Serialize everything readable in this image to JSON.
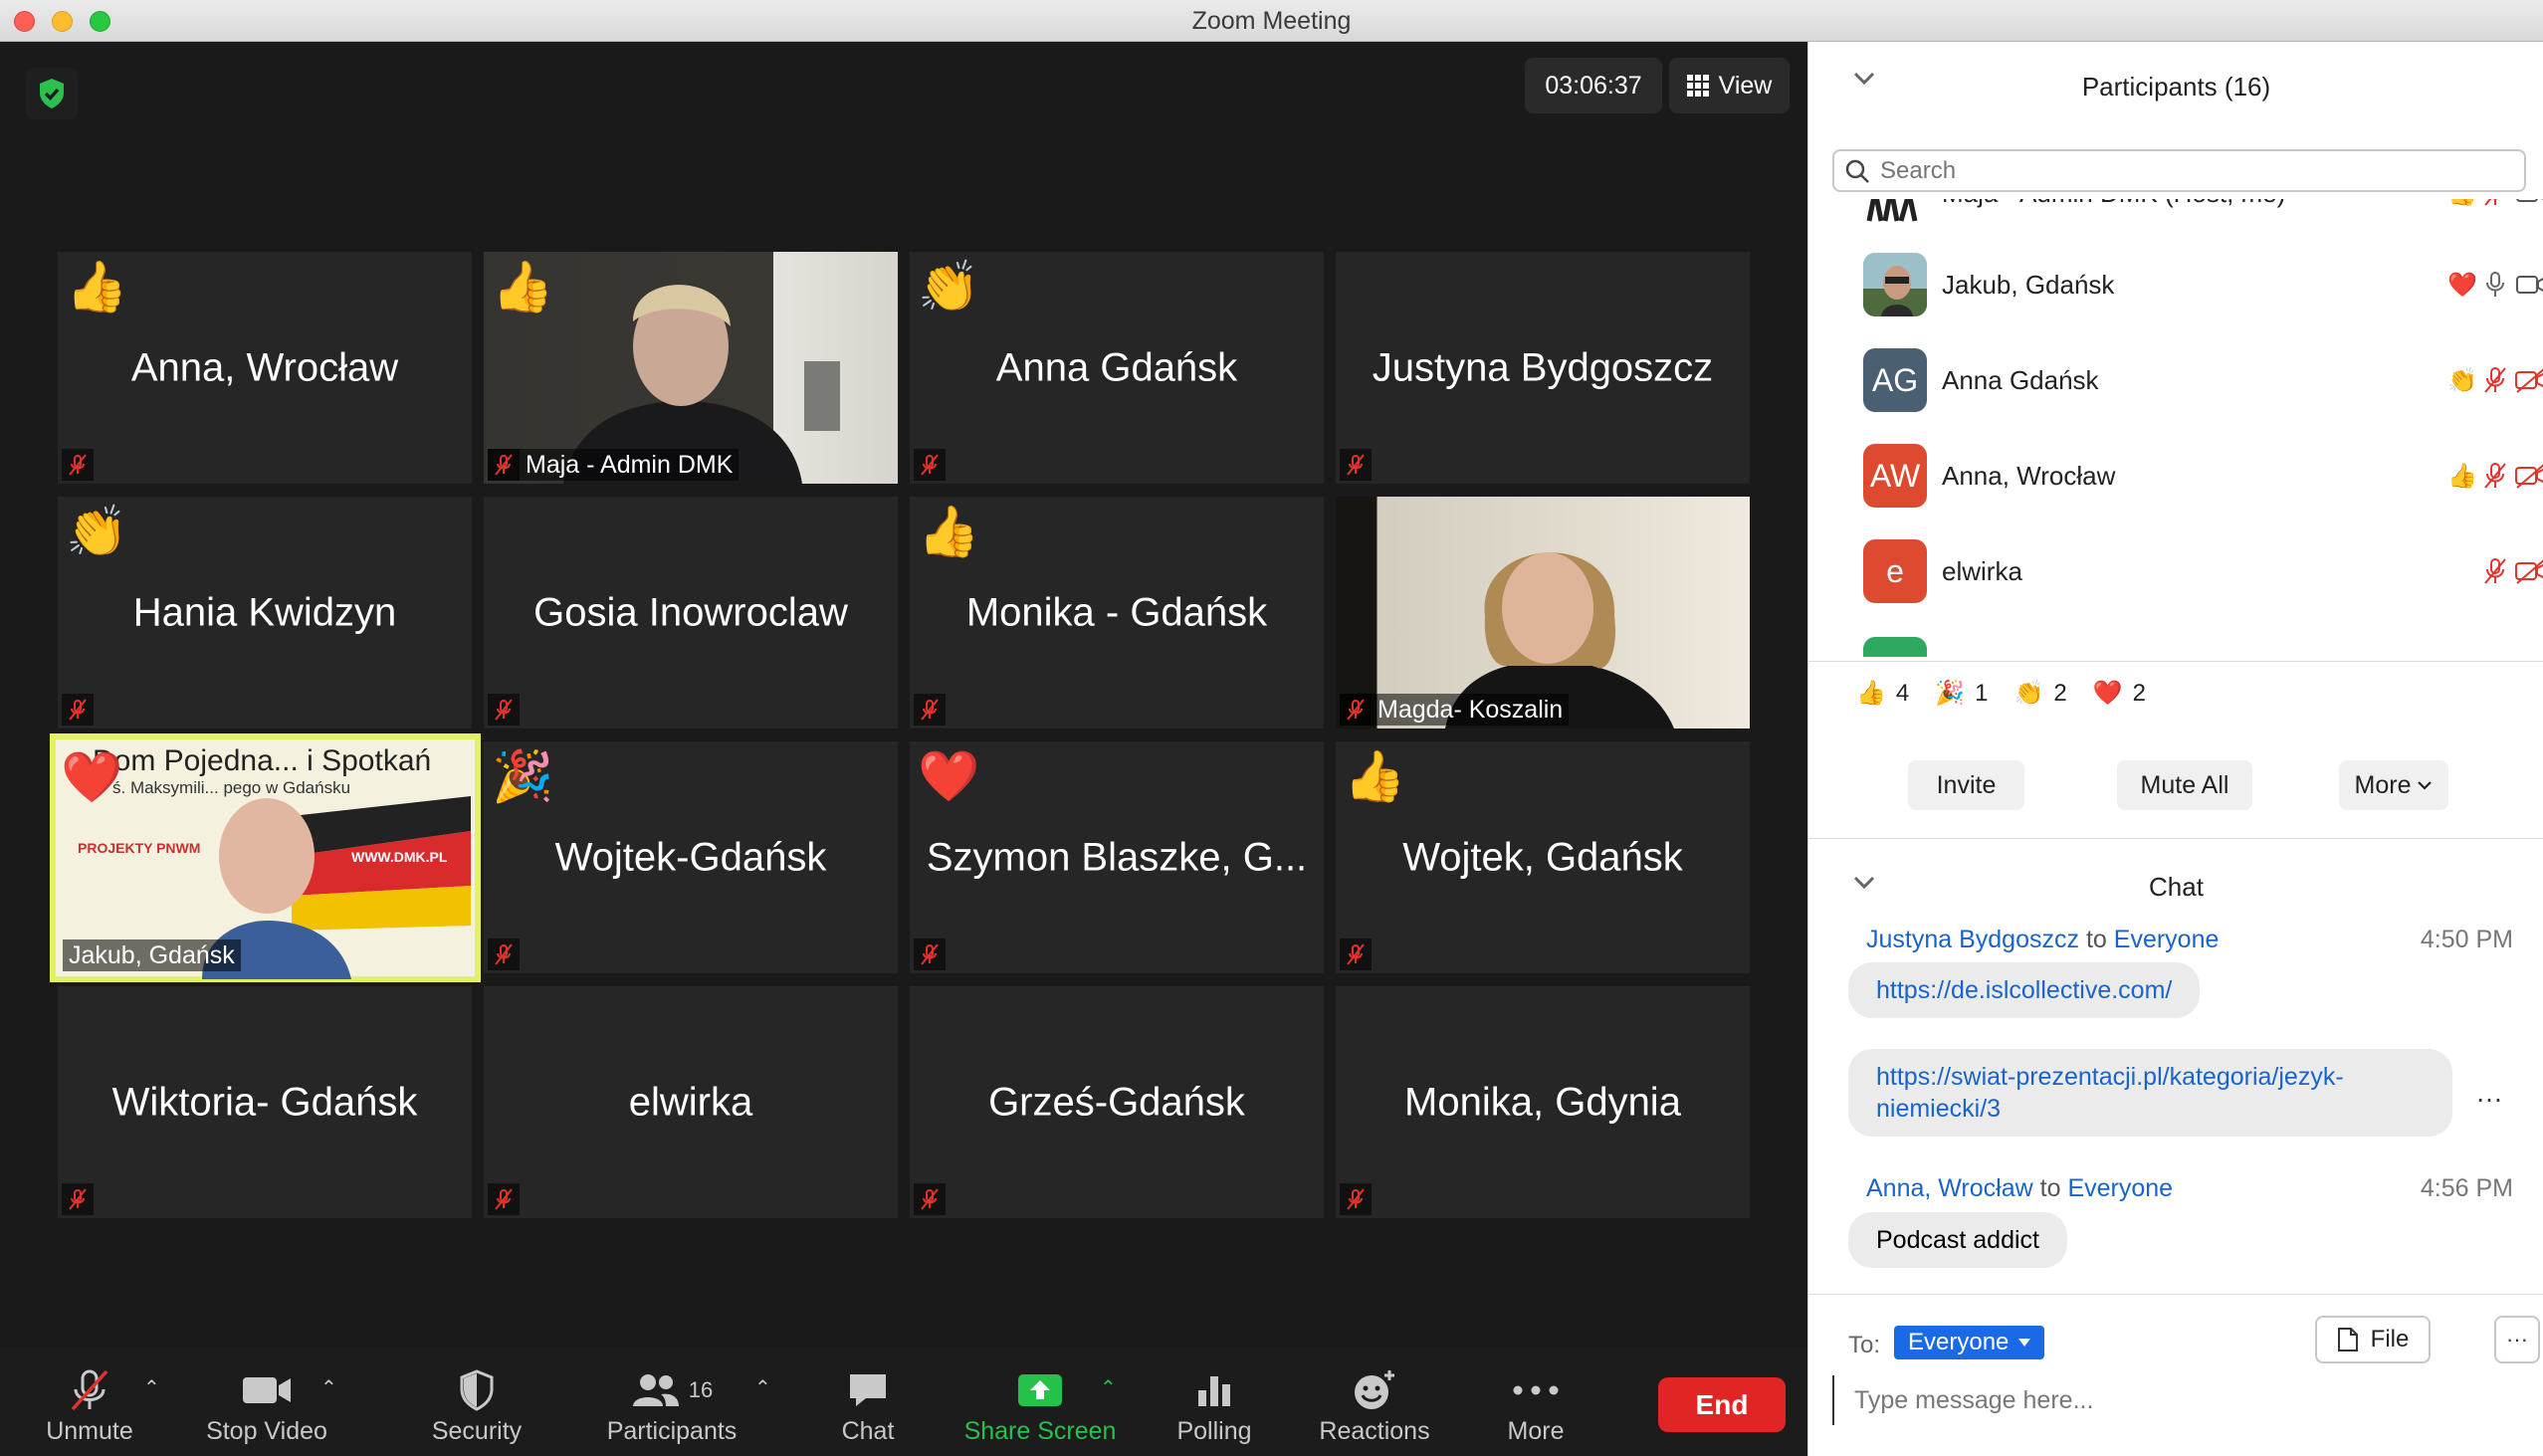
{
  "window": {
    "title": "Zoom Meeting"
  },
  "meeting": {
    "timer": "03:06:37",
    "view_label": "View"
  },
  "tiles": [
    {
      "name": "Anna, Wrocław",
      "reaction": "👍"
    },
    {
      "name": "Maja - Admin DMK",
      "reaction": "👍"
    },
    {
      "name": "Anna Gdańsk",
      "reaction": "👏"
    },
    {
      "name": "Justyna  Bydgoszcz",
      "reaction": ""
    },
    {
      "name": "Hania Kwidzyn",
      "reaction": "👏"
    },
    {
      "name": "Gosia Inowroclaw",
      "reaction": ""
    },
    {
      "name": "Monika - Gdańsk",
      "reaction": "👍"
    },
    {
      "name": "Magda- Koszalin",
      "reaction": ""
    },
    {
      "name": "Jakub, Gdańsk",
      "reaction": "❤️",
      "banner_title": "Dom Pojedna... i Spotkań",
      "banner_sub": "ś. Maksymili... pego w Gdańsku",
      "banner_projects": "PROJEKTY PNWM",
      "banner_url": "WWW.DMK.PL"
    },
    {
      "name": "Wojtek-Gdańsk",
      "reaction": "🎉"
    },
    {
      "name": "Szymon Blaszke, G...",
      "reaction": "❤️"
    },
    {
      "name": "Wojtek, Gdańsk",
      "reaction": "👍"
    },
    {
      "name": "Wiktoria- Gdańsk",
      "reaction": ""
    },
    {
      "name": "elwirka",
      "reaction": ""
    },
    {
      "name": "Grześ-Gdańsk",
      "reaction": ""
    },
    {
      "name": "Monika, Gdynia",
      "reaction": ""
    }
  ],
  "toolbar": {
    "unmute": "Unmute",
    "stop_video": "Stop Video",
    "security": "Security",
    "participants": "Participants",
    "participants_count": "16",
    "chat": "Chat",
    "share_screen": "Share Screen",
    "polling": "Polling",
    "reactions": "Reactions",
    "more": "More",
    "end": "End"
  },
  "panel": {
    "title": "Participants (16)",
    "search_placeholder": "Search",
    "participants": [
      {
        "name": "Maja - Admin DMK (Host, me)",
        "initials": "",
        "avatar_color": "#ffffff",
        "reaction": "👍"
      },
      {
        "name": "Jakub, Gdańsk",
        "initials": "",
        "avatar_color": "#7aa9b5",
        "reaction": "❤️"
      },
      {
        "name": "Anna Gdańsk",
        "initials": "AG",
        "avatar_color": "#4a6072",
        "reaction": "👏"
      },
      {
        "name": "Anna, Wrocław",
        "initials": "AW",
        "avatar_color": "#dd4a2f",
        "reaction": "👍"
      },
      {
        "name": "elwirka",
        "initials": "e",
        "avatar_color": "#dd4a2f",
        "reaction": ""
      }
    ],
    "reaction_counts": [
      {
        "emoji": "👍",
        "count": "4"
      },
      {
        "emoji": "🎉",
        "count": "1"
      },
      {
        "emoji": "👏",
        "count": "2"
      },
      {
        "emoji": "❤️",
        "count": "2"
      }
    ],
    "invite": "Invite",
    "mute_all": "Mute All",
    "more": "More"
  },
  "chat": {
    "title": "Chat",
    "messages": [
      {
        "sender": "Justyna  Bydgoszcz",
        "to_word": "to",
        "recipient": "Everyone",
        "time": "4:50 PM"
      },
      {
        "sender": "Anna, Wrocław",
        "to_word": "to",
        "recipient": "Everyone",
        "time": "4:56 PM"
      }
    ],
    "bubble1": "https://de.islcollective.com/",
    "bubble2": "https://swiat-prezentacji.pl/kategoria/jezyk-niemiecki/3",
    "bubble3": "Podcast addict",
    "bubble_more": "…",
    "to_label": "To:",
    "to_value": "Everyone",
    "file_label": "File",
    "more_dots": "···",
    "input_placeholder": "Type message here..."
  }
}
